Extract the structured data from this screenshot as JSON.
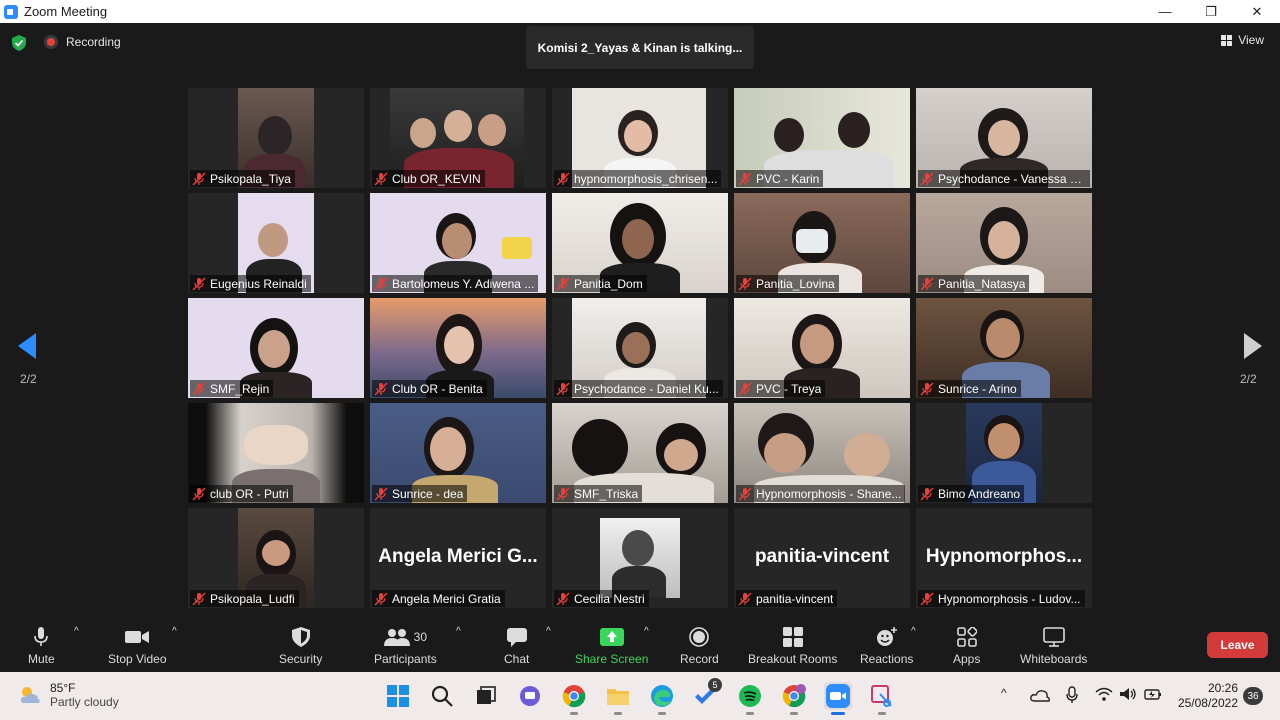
{
  "window": {
    "title": "Zoom Meeting",
    "minimize_glyph": "—",
    "maximize_glyph": "❐",
    "close_glyph": "✕"
  },
  "meeting": {
    "recording_label": "Recording",
    "talking_banner": "Komisi 2_Yayas & Kinan is talking...",
    "view_label": "View",
    "page_left": "2/2",
    "page_right": "2/2"
  },
  "participants": [
    {
      "name": "Psikopala_Tiya"
    },
    {
      "name": "Club OR_KEVIN"
    },
    {
      "name": "hypnomorphosis_chrisen..."
    },
    {
      "name": "PVC - Karin"
    },
    {
      "name": "Psychodance - Vanessa D..."
    },
    {
      "name": "Eugenius Reinaldi"
    },
    {
      "name": "Bartolomeus Y. Adiwena ..."
    },
    {
      "name": "Panitia_Dom"
    },
    {
      "name": "Panitia_Lovina"
    },
    {
      "name": "Panitia_Natasya"
    },
    {
      "name": "SMF_Rejin"
    },
    {
      "name": "Club OR - Benita"
    },
    {
      "name": "Psychodance - Daniel Ku..."
    },
    {
      "name": "PVC - Treya"
    },
    {
      "name": "Sunrice - Arino"
    },
    {
      "name": "club OR - Putri"
    },
    {
      "name": "Sunrice - dea"
    },
    {
      "name": "SMF_Triska"
    },
    {
      "name": "Hypnomorphosis - Shane..."
    },
    {
      "name": "Bimo Andreano"
    },
    {
      "name": "Psikopala_Ludfi"
    },
    {
      "name": "Angela Merici Gratia",
      "display": "Angela Merici G..."
    },
    {
      "name": "Cecilia Nestri"
    },
    {
      "name": "panitia-vincent",
      "display": "panitia-vincent"
    },
    {
      "name": "Hypnomorphosis - Ludov...",
      "display": "Hypnomorphos..."
    }
  ],
  "toolbar": {
    "mute": "Mute",
    "stop_video": "Stop Video",
    "security": "Security",
    "participants": "Participants",
    "participants_count": "30",
    "chat": "Chat",
    "share_screen": "Share Screen",
    "record": "Record",
    "breakout_rooms": "Breakout Rooms",
    "reactions": "Reactions",
    "apps": "Apps",
    "whiteboards": "Whiteboards",
    "leave": "Leave",
    "caret_glyph": "^"
  },
  "taskbar": {
    "weather_temp": "85°F",
    "weather_condition": "Partly cloudy",
    "todo_badge": "5",
    "time": "20:26",
    "date": "25/08/2022",
    "notifications": "36",
    "tray_caret": "^"
  },
  "colors": {
    "background": "#1a1a1a",
    "share_green": "#3ad65c",
    "leave_red": "#d33a3a",
    "muted_red": "#e8403a",
    "nav_blue": "#2d8cff"
  }
}
